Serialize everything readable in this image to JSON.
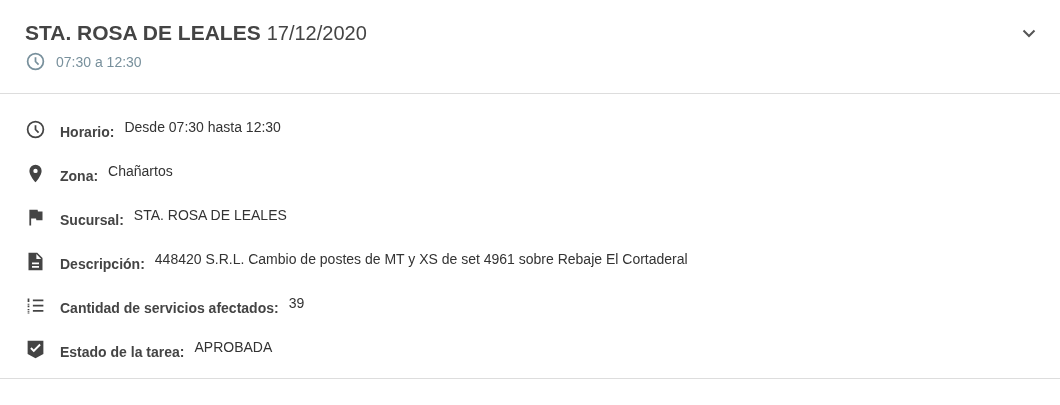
{
  "panel": {
    "title": "STA. ROSA DE LEALES",
    "date": "17/12/2020",
    "time_range": "07:30 a 12:30",
    "expanded": true,
    "details": [
      {
        "kind": "clock",
        "label": "Horario:",
        "value": "Desde 07:30 hasta 12:30"
      },
      {
        "kind": "pin",
        "label": "Zona:",
        "value": "Chañartos"
      },
      {
        "kind": "flag",
        "label": "Sucursal:",
        "value": "STA. ROSA DE LEALES"
      },
      {
        "kind": "document",
        "label": "Descripción:",
        "value": "448420 S.R.L. Cambio de postes de MT y XS de set 4961 sobre Rebaje El Cortaderal"
      },
      {
        "kind": "list",
        "label": "Cantidad de servicios afectados:",
        "value": "39"
      },
      {
        "kind": "shield",
        "label": "Estado de la tarea:",
        "value": "APROBADA"
      }
    ]
  }
}
